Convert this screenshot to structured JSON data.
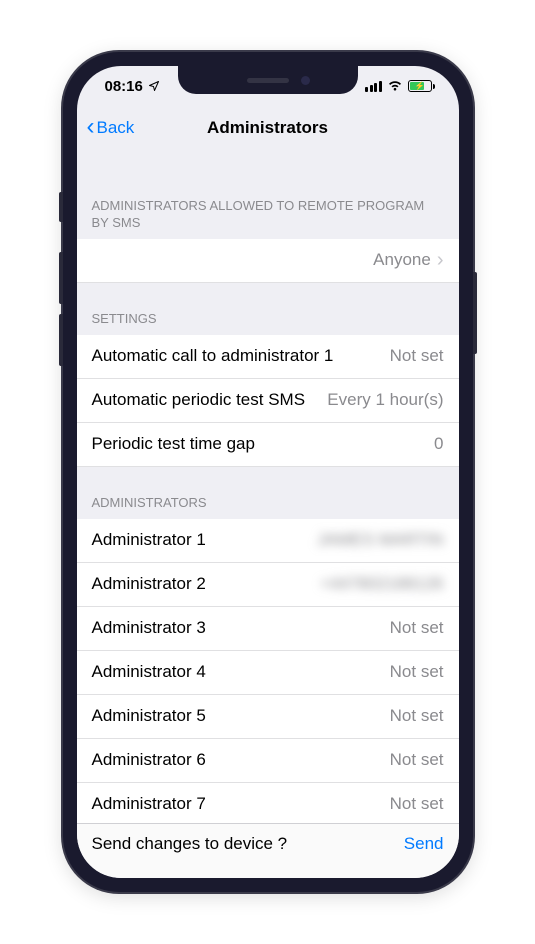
{
  "statusBar": {
    "time": "08:16"
  },
  "nav": {
    "backLabel": "Back",
    "title": "Administrators"
  },
  "sections": {
    "remoteHeader": "ADMINISTRATORS ALLOWED TO REMOTE PROGRAM BY SMS",
    "remoteValue": "Anyone",
    "settingsHeader": "SETTINGS",
    "settings": [
      {
        "label": "Automatic call to administrator 1",
        "value": "Not set"
      },
      {
        "label": "Automatic periodic test SMS",
        "value": "Every 1 hour(s)"
      },
      {
        "label": "Periodic test time gap",
        "value": "0"
      }
    ],
    "adminsHeader": "ADMINISTRATORS",
    "admins": [
      {
        "label": "Administrator 1",
        "value": "JAMES MARTIN",
        "blurred": true
      },
      {
        "label": "Administrator 2",
        "value": "+447802188126",
        "blurred": true
      },
      {
        "label": "Administrator 3",
        "value": "Not set"
      },
      {
        "label": "Administrator 4",
        "value": "Not set"
      },
      {
        "label": "Administrator 5",
        "value": "Not set"
      },
      {
        "label": "Administrator 6",
        "value": "Not set"
      },
      {
        "label": "Administrator 7",
        "value": "Not set"
      }
    ]
  },
  "bottom": {
    "prompt": "Send changes to device ?",
    "action": "Send"
  }
}
